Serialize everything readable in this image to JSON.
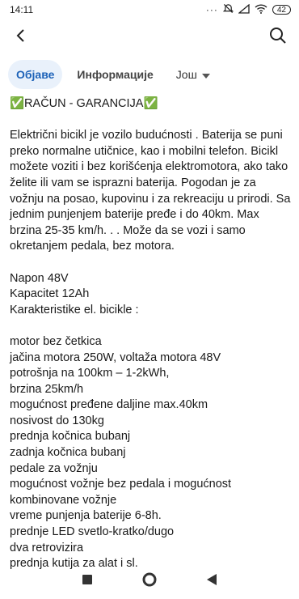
{
  "status_bar": {
    "time": "14:11",
    "battery": "42"
  },
  "app_bar": {
    "back_icon": "arrow-left-icon",
    "search_icon": "search-icon"
  },
  "tabs": [
    {
      "label": "Објаве",
      "active": true
    },
    {
      "label": "Информације",
      "active": false
    },
    {
      "label": "Још",
      "active": false
    }
  ],
  "content": {
    "heading": "✅RAČUN - GARANCIJA✅",
    "intro": "Električni bicikl je vozilo budućnosti . Baterija se puni preko normalne utičnice, kao i mobilni telefon. Bicikl možete voziti i bez korišćenja elektromotora, ako tako želite ili vam se isprazni baterija. Pogodan je za vožnju na posao, kupovinu i za rekreaciju u prirodi. Sa jednim punjenjem baterije pređe i do 40km. Max brzina 25-35 km/h. . . Može da se vozi i samo okretanjem pedala, bez motora.",
    "napon": "Napon 48V",
    "kapacitet": "Kapacitet 12Ah",
    "karakteristike": "Karakteristike el. bicikle :",
    "features": [
      "motor bez četkica",
      "jačina motora 250W, voltaža motora 48V",
      "potrošnja na 100km – 1-2kWh,",
      "brzina 25km/h",
      "mogućnost pređene daljine max.40km",
      "nosivost do 130kg",
      "prednja kočnica bubanj",
      "zadnja kočnica bubanj",
      "pedale za vožnju",
      "mogućnost vožnje bez pedala i mogućnost kombinovane vožnje",
      "vreme punjenja baterije 6-8h.",
      "prednje LED svetlo-kratko/dugo",
      "dva retrovizira",
      "prednja kutija za alat i sl."
    ]
  },
  "nav_bar": {
    "recents": "square-icon",
    "home": "circle-icon",
    "back": "triangle-back-icon"
  }
}
